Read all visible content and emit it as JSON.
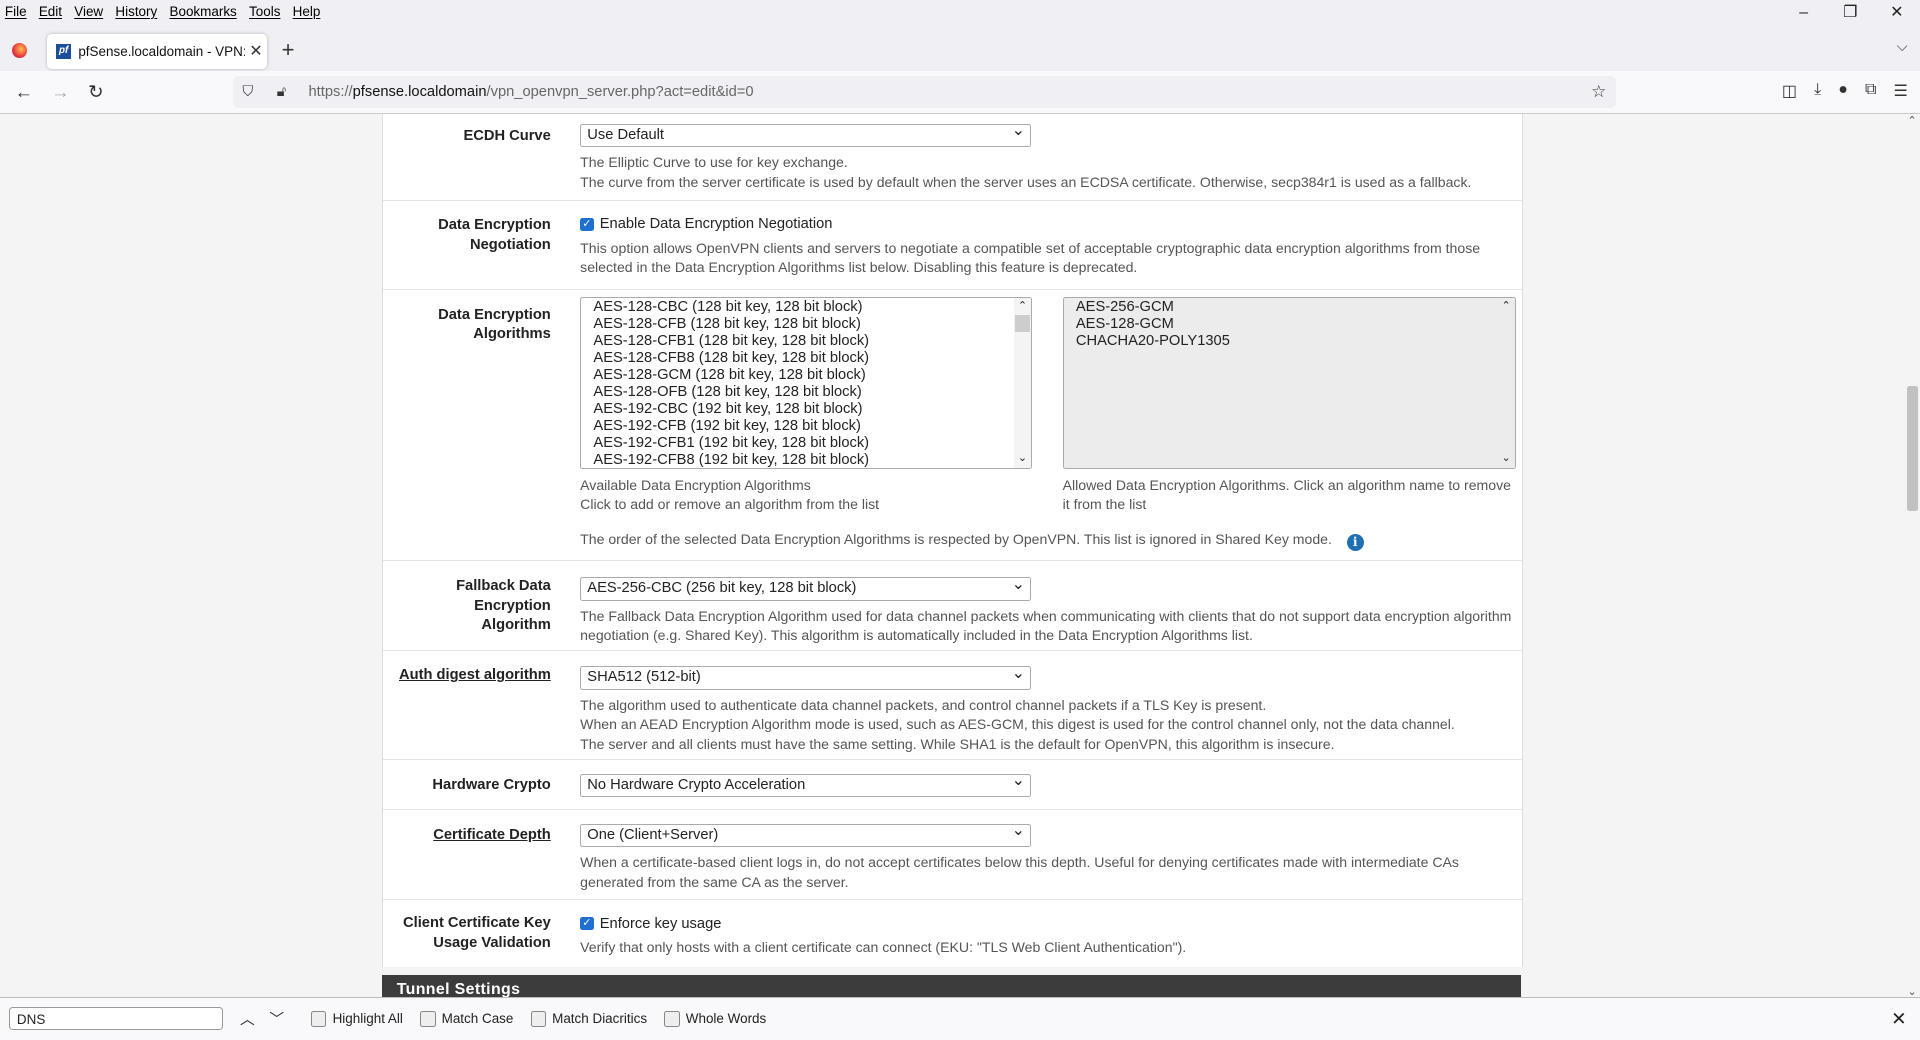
{
  "menubar": [
    "File",
    "Edit",
    "View",
    "History",
    "Bookmarks",
    "Tools",
    "Help"
  ],
  "tab": {
    "title": "pfSense.localdomain - VPN: Op",
    "favicon": "pf"
  },
  "url": {
    "prefix": "https://",
    "host": "pfsense.localdomain",
    "path": "/vpn_openvpn_server.php?act=edit&id=0"
  },
  "form": {
    "ecdh": {
      "label": "ECDH Curve",
      "value": "Use Default",
      "help1": "The Elliptic Curve to use for key exchange.",
      "help2": "The curve from the server certificate is used by default when the server uses an ECDSA certificate. Otherwise, secp384r1 is used as a fallback."
    },
    "den": {
      "label1": "Data Encryption",
      "label2": "Negotiation",
      "checkbox": "Enable Data Encryption Negotiation",
      "checked": true,
      "help": "This option allows OpenVPN clients and servers to negotiate a compatible set of acceptable cryptographic data encryption algorithms from those selected in the Data Encryption Algorithms list below. Disabling this feature is deprecated."
    },
    "dea": {
      "label1": "Data Encryption",
      "label2": "Algorithms",
      "available": [
        "AES-128-CBC (128 bit key, 128 bit block)",
        "AES-128-CFB (128 bit key, 128 bit block)",
        "AES-128-CFB1 (128 bit key, 128 bit block)",
        "AES-128-CFB8 (128 bit key, 128 bit block)",
        "AES-128-GCM (128 bit key, 128 bit block)",
        "AES-128-OFB (128 bit key, 128 bit block)",
        "AES-192-CBC (192 bit key, 128 bit block)",
        "AES-192-CFB (192 bit key, 128 bit block)",
        "AES-192-CFB1 (192 bit key, 128 bit block)",
        "AES-192-CFB8 (192 bit key, 128 bit block)"
      ],
      "allowed": [
        "AES-256-GCM",
        "AES-128-GCM",
        "CHACHA20-POLY1305"
      ],
      "available_help1": "Available Data Encryption Algorithms",
      "available_help2": "Click to add or remove an algorithm from the list",
      "allowed_help": "Allowed Data Encryption Algorithms. Click an algorithm name to remove it from the list",
      "order_note": "The order of the selected Data Encryption Algorithms is respected by OpenVPN. This list is ignored in Shared Key mode."
    },
    "fallback": {
      "label1": "Fallback Data Encryption",
      "label2": "Algorithm",
      "value": "AES-256-CBC (256 bit key, 128 bit block)",
      "help": "The Fallback Data Encryption Algorithm used for data channel packets when communicating with clients that do not support data encryption algorithm negotiation (e.g. Shared Key). This algorithm is automatically included in the Data Encryption Algorithms list."
    },
    "auth": {
      "label": "Auth digest algorithm",
      "value": "SHA512 (512-bit)",
      "help1": "The algorithm used to authenticate data channel packets, and control channel packets if a TLS Key is present.",
      "help2": "When an AEAD Encryption Algorithm mode is used, such as AES-GCM, this digest is used for the control channel only, not the data channel.",
      "help3": "The server and all clients must have the same setting. While SHA1 is the default for OpenVPN, this algorithm is insecure."
    },
    "hw": {
      "label": "Hardware Crypto",
      "value": "No Hardware Crypto Acceleration"
    },
    "depth": {
      "label": "Certificate Depth",
      "value": "One (Client+Server)",
      "help": "When a certificate-based client logs in, do not accept certificates below this depth. Useful for denying certificates made with intermediate CAs generated from the same CA as the server."
    },
    "eku": {
      "label1": "Client Certificate Key",
      "label2": "Usage Validation",
      "checkbox": "Enforce key usage",
      "checked": true,
      "help": "Verify that only hosts with a client certificate can connect (EKU: \"TLS Web Client Authentication\")."
    }
  },
  "section": "Tunnel Settings",
  "findbar": {
    "query": "DNS",
    "options": [
      "Highlight All",
      "Match Case",
      "Match Diacritics",
      "Whole Words"
    ]
  },
  "colors": {
    "accent": "#1f6fd0",
    "section_bg": "#3c3c3c",
    "info": "#1f6fb5"
  }
}
